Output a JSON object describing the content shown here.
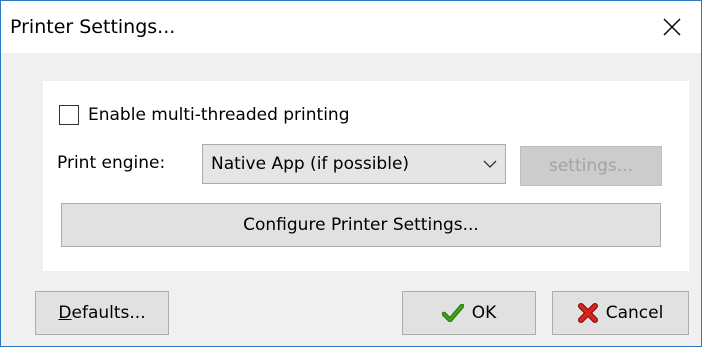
{
  "window": {
    "title": "Printer Settings...",
    "close_icon": "close-icon"
  },
  "options": {
    "multithread_label": "Enable multi-threaded printing",
    "multithread_checked": false
  },
  "engine": {
    "label": "Print engine:",
    "selected": "Native App (if possible)",
    "settings_label": "settings...",
    "settings_enabled": false
  },
  "configure": {
    "label": "Configure Printer Settings..."
  },
  "footer": {
    "defaults_mnemonic": "D",
    "defaults_rest": "efaults...",
    "ok_label": "OK",
    "ok_icon": "checkmark-icon",
    "cancel_label": "Cancel",
    "cancel_icon": "red-x-icon"
  },
  "colors": {
    "window_border": "#2b79c2",
    "ok_icon": "#3aa617",
    "cancel_icon": "#d9241b"
  }
}
